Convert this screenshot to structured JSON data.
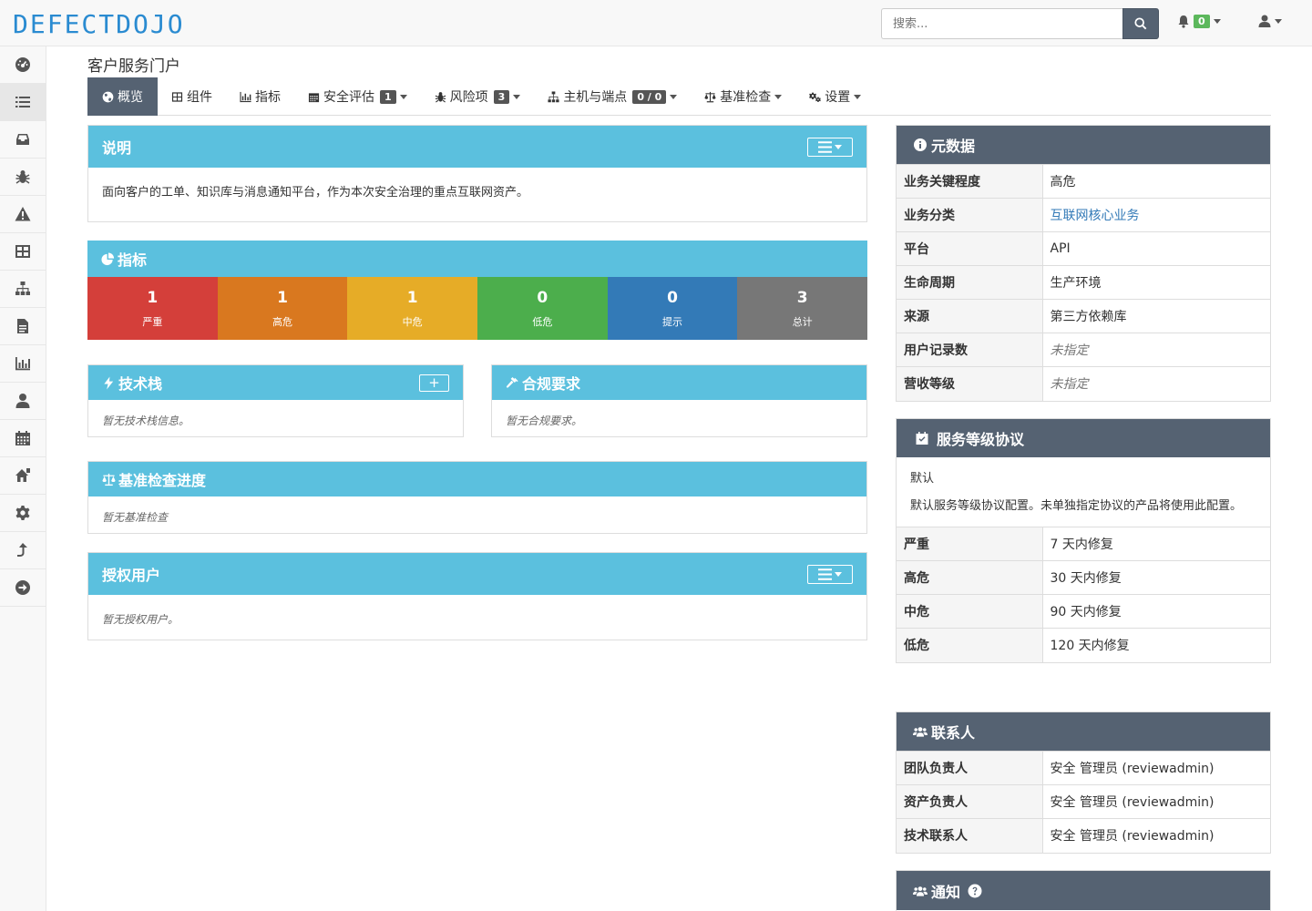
{
  "app": {
    "logo": "DEFECTDOJO"
  },
  "header": {
    "search_placeholder": "搜索...",
    "notifications_count": "0"
  },
  "sidebar": {
    "items": [
      "dashboard-icon",
      "list-icon",
      "inbox-icon",
      "bug-icon",
      "warning-icon",
      "grid-icon",
      "sitemap-icon",
      "file-icon",
      "chart-icon",
      "user-icon",
      "calendar-icon",
      "house-icon",
      "gear-icon",
      "share-icon",
      "arrow-right-icon"
    ],
    "active_index": 1
  },
  "page": {
    "title": "客户服务门户"
  },
  "tabs": [
    {
      "label": "概览",
      "icon": "globe-icon",
      "active": true
    },
    {
      "label": "组件",
      "icon": "table-icon"
    },
    {
      "label": "指标",
      "icon": "bar-chart-icon"
    },
    {
      "label": "安全评估",
      "icon": "calendar-icon",
      "badge": "1",
      "dropdown": true
    },
    {
      "label": "风险项",
      "icon": "bug-icon",
      "badge": "3",
      "dropdown": true
    },
    {
      "label": "主机与端点",
      "icon": "sitemap-icon",
      "badge": "0 / 0",
      "dropdown": true
    },
    {
      "label": "基准检查",
      "icon": "balance-icon",
      "dropdown": true
    },
    {
      "label": "设置",
      "icon": "gears-icon",
      "dropdown": true
    }
  ],
  "description": {
    "title": "说明",
    "text": "面向客户的工单、知识库与消息通知平台，作为本次安全治理的重点互联网资产。"
  },
  "metrics": {
    "title": "指标",
    "items": [
      {
        "value": "1",
        "label": "严重",
        "color": "#d43f3a"
      },
      {
        "value": "1",
        "label": "高危",
        "color": "#d9781f"
      },
      {
        "value": "1",
        "label": "中危",
        "color": "#e6ac27"
      },
      {
        "value": "0",
        "label": "低危",
        "color": "#4cae4c"
      },
      {
        "value": "0",
        "label": "提示",
        "color": "#337ab7"
      },
      {
        "value": "3",
        "label": "总计",
        "color": "#777777"
      }
    ]
  },
  "tech_stack": {
    "title": "技术栈",
    "empty": "暂无技术栈信息。"
  },
  "compliance": {
    "title": "合规要求",
    "empty": "暂无合规要求。"
  },
  "benchmark": {
    "title": "基准检查进度",
    "empty": "暂无基准检查"
  },
  "authorized_users": {
    "title": "授权用户",
    "empty": "暂无授权用户。"
  },
  "metadata": {
    "title": "元数据",
    "rows": [
      {
        "key": "业务关键程度",
        "value": "高危"
      },
      {
        "key": "业务分类",
        "value": "互联网核心业务"
      },
      {
        "key": "平台",
        "value": "API"
      },
      {
        "key": "生命周期",
        "value": "生产环境"
      },
      {
        "key": "来源",
        "value": "第三方依赖库"
      },
      {
        "key": "用户记录数",
        "value": "未指定"
      },
      {
        "key": "营收等级",
        "value": "未指定"
      }
    ]
  },
  "sla": {
    "title": "服务等级协议",
    "name": "默认",
    "description": "默认服务等级协议配置。未单独指定协议的产品将使用此配置。",
    "rows": [
      {
        "key": "严重",
        "value": "7 天内修复"
      },
      {
        "key": "高危",
        "value": "30 天内修复"
      },
      {
        "key": "中危",
        "value": "90 天内修复"
      },
      {
        "key": "低危",
        "value": "120 天内修复"
      }
    ]
  },
  "contacts": {
    "title": "联系人",
    "rows": [
      {
        "key": "团队负责人",
        "value": "安全 管理员 (reviewadmin)"
      },
      {
        "key": "资产负责人",
        "value": "安全 管理员 (reviewadmin)"
      },
      {
        "key": "技术联系人",
        "value": "安全 管理员 (reviewadmin)"
      }
    ]
  },
  "notifications": {
    "title": "通知"
  }
}
